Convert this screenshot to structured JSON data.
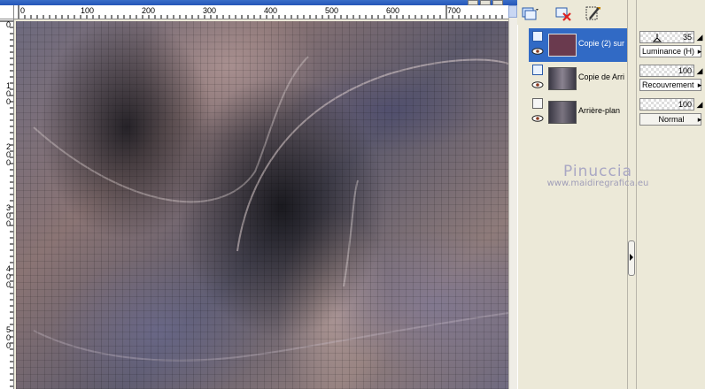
{
  "canvas": {
    "ruler_h_labels": [
      "0",
      "100",
      "200",
      "300",
      "400",
      "500",
      "600",
      "700"
    ],
    "ruler_v_labels": [
      "0",
      "100",
      "200",
      "300",
      "400",
      "500"
    ]
  },
  "layers": [
    {
      "name": "Copie (2) sur",
      "selected": true,
      "visible": true,
      "thumb_color": "#6a3a4e"
    },
    {
      "name": "Copie de Arri",
      "selected": false,
      "visible": true,
      "thumb_color": "#5e5c68"
    },
    {
      "name": "Arrière-plan",
      "selected": false,
      "visible": true,
      "thumb_color": "#5a5864"
    }
  ],
  "properties": [
    {
      "opacity": "35",
      "blend_mode": "Luminance (H)"
    },
    {
      "opacity": "100",
      "blend_mode": "Recouvrement"
    },
    {
      "opacity": "100",
      "blend_mode": "Normal"
    }
  ],
  "watermark": {
    "title": "Pinuccia",
    "url": "www.maidiregrafica.eu"
  },
  "colors": {
    "selected_row": "#316ac5",
    "canvas_grid": "#000000",
    "panel_bg": "#ece9d8"
  },
  "icons": {
    "toolbar": [
      "new-layer-icon",
      "delete-layer-icon",
      "properties-icon"
    ],
    "layer_row": [
      "raster-layer-icon",
      "eye-icon"
    ]
  }
}
